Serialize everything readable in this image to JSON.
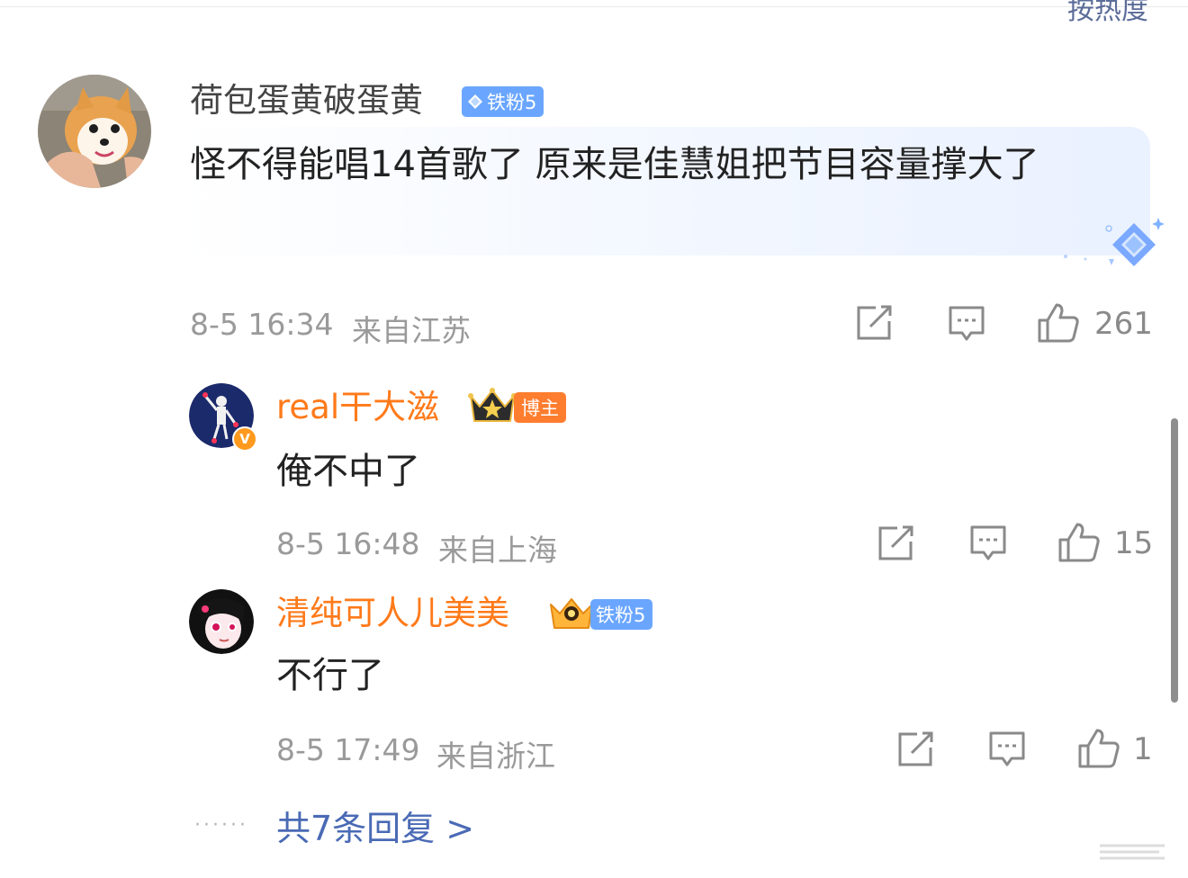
{
  "header": {
    "sort_label": "按热度"
  },
  "comment": {
    "username": "荷包蛋黄破蛋黄",
    "badge_label": "铁粉5",
    "text": "怪不得能唱14首歌了 原来是佳慧姐把节目容量撑大了",
    "time": "8-5 16:34",
    "location": "来自江苏",
    "likes": "261",
    "avatar_icon": "corgi-photo"
  },
  "replies": [
    {
      "username": "real干大滋",
      "badge_label": "博主",
      "text": "俺不中了",
      "time": "8-5 16:48",
      "location": "来自上海",
      "likes": "15",
      "avatar_icon": "dancing-figure-avatar",
      "verified": "V"
    },
    {
      "username": "清纯可人儿美美",
      "badge_label": "铁粉5",
      "text": "不行了",
      "time": "8-5 17:49",
      "location": "来自浙江",
      "likes": "1",
      "avatar_icon": "anime-girl-avatar"
    }
  ],
  "footer": {
    "more_replies": "共7条回复 >",
    "dots": "······"
  },
  "colors": {
    "name_orange": "#ff7a1a",
    "link_blue": "#4a6ab5",
    "fan_badge_blue": "#6aa6ff",
    "blogger_badge_orange": "#ff7d2e",
    "meta_gray": "#9a9a9a"
  }
}
